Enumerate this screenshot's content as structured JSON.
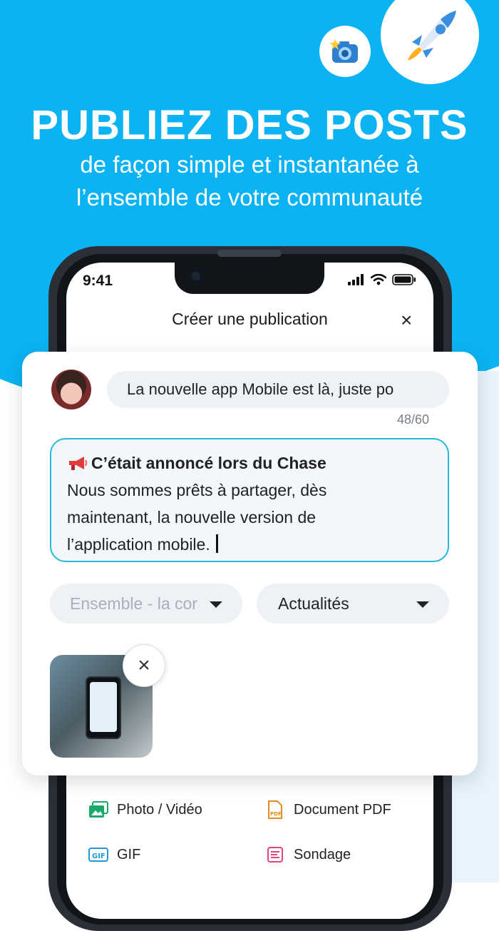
{
  "hero": {
    "title": "PUBLIEZ DES POSTS",
    "subtitle_line1": "de façon simple et instantanée à",
    "subtitle_line2": "l’ensemble de votre communauté"
  },
  "status_bar": {
    "time": "9:41"
  },
  "modal": {
    "title": "Créer une publication",
    "close_label": "×"
  },
  "post": {
    "title_value": "La nouvelle app Mobile est là, juste po",
    "counter": "48/60",
    "body_title": "C’était annoncé lors du Chase",
    "body_text": "Nous sommes prêts à partager, dès\nmaintenant, la nouvelle version de\nl’application mobile.",
    "community_placeholder": "Ensemble - la cor",
    "category": "Actualités",
    "remove_label": "×"
  },
  "attachments": [
    {
      "label": "Photo / Vidéo",
      "icon": "photo-video-icon",
      "color": "#1aa96a"
    },
    {
      "label": "Document PDF",
      "icon": "pdf-icon",
      "color": "#e58a1f"
    },
    {
      "label": "GIF",
      "icon": "gif-icon",
      "color": "#1f9ad6"
    },
    {
      "label": "Sondage",
      "icon": "poll-icon",
      "color": "#e0457b"
    }
  ],
  "colors": {
    "brand_blue": "#0bb3f2",
    "focus_border": "#29b8d9"
  }
}
